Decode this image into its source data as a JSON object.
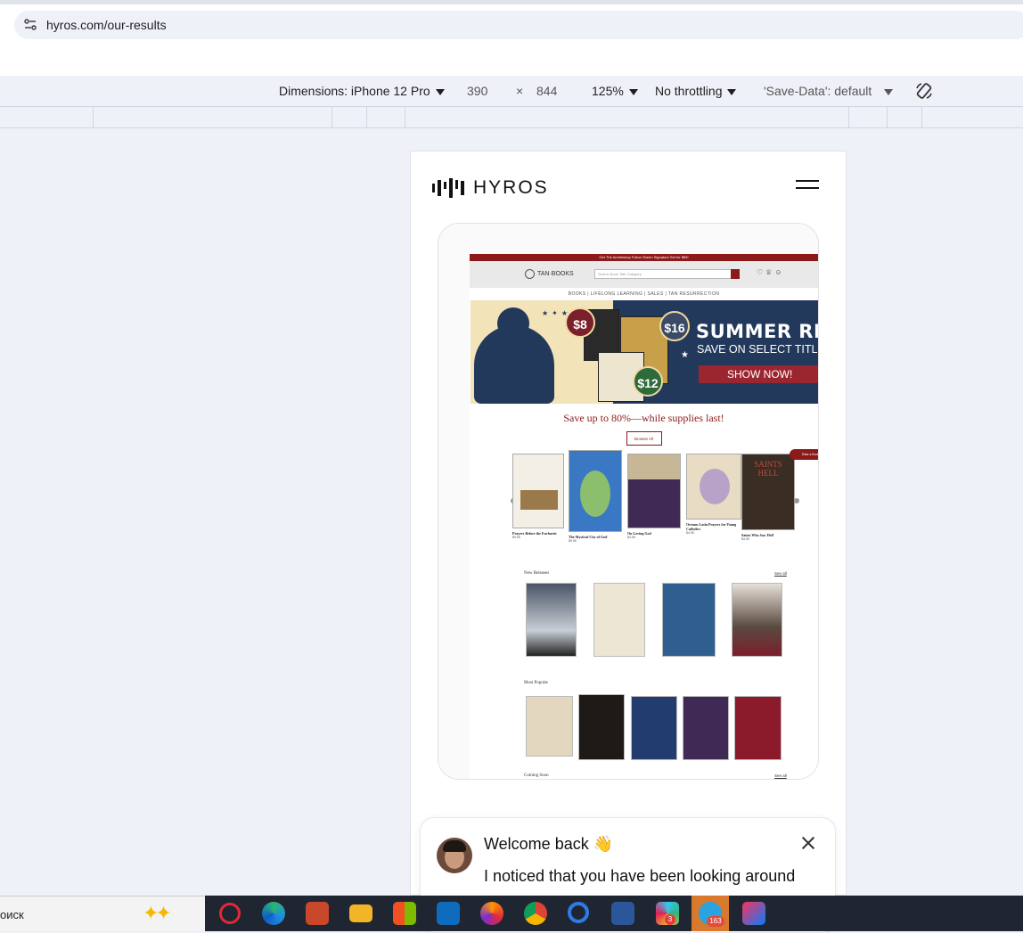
{
  "browser": {
    "url": "hyros.com/our-results"
  },
  "devtools": {
    "dimensions_label": "Dimensions: iPhone 12 Pro",
    "width": "390",
    "times": "×",
    "height": "844",
    "zoom": "125%",
    "throttling": "No throttling",
    "save_data": "'Save-Data': default"
  },
  "hyros": {
    "logo_text": "HYROS"
  },
  "tan_site": {
    "promo": "Get The Archbishop Fulton Sheen Signature Set for $65!",
    "logo": "TAN·BOOKS",
    "search_placeholder": "Search Book Title Category",
    "nav": "BOOKS  |  LIFELONG LEARNING  |  SALES  |  TAN RESURRECTION",
    "hero": {
      "price_1": "$8",
      "price_2": "$16",
      "price_3": "$12",
      "title": "SUMMER READIN",
      "subtitle": "SAVE ON SELECT TITL",
      "button": "SHOW NOW!"
    },
    "save_line": "Save up to 80%—while supplies last!",
    "browse_all": "Browse All",
    "reviews_pill": "Rate a Book",
    "carousel": [
      {
        "title": "Prayers Before the Eucharist",
        "price": "$9.95"
      },
      {
        "title": "The Mystical City of God",
        "price": "$9.95"
      },
      {
        "title": "On Loving God",
        "price": "$4.95"
      },
      {
        "title": "Oremus Latin Prayers for Young Catholics",
        "price": "$4.95"
      },
      {
        "title": "Saints Who Saw Hell",
        "price": "$4.95"
      }
    ],
    "new_releases": "New Releases",
    "most_popular": "Most Popular",
    "coming_soon": "Coming Soon",
    "see_all": "See all"
  },
  "chat": {
    "title": "Welcome back 👋",
    "message": "I noticed that you have been looking around"
  },
  "taskbar": {
    "search_text": "оиск",
    "telegram_badge": "163",
    "slack_badge": "3"
  },
  "colors": {
    "tan_red": "#8b1a1a",
    "hero_navy": "#23395b",
    "taskbar": "#1f2631"
  }
}
